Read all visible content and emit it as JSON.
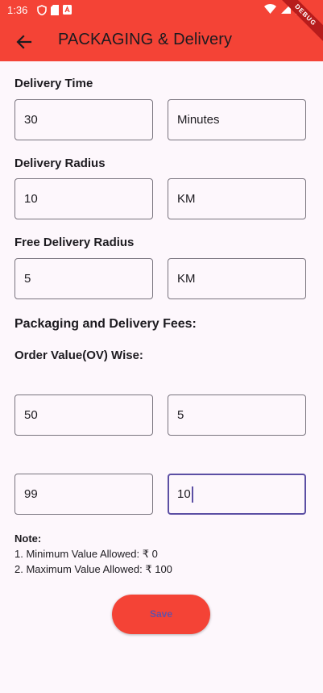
{
  "status_bar": {
    "time": "1:36",
    "icons_left": [
      "shield-icon",
      "sd-card-icon",
      "a-icon"
    ],
    "icons_right": [
      "wifi-icon",
      "signal-icon",
      "battery-icon"
    ]
  },
  "app_bar": {
    "title": "PACKAGING & Delivery",
    "debug_banner": "DEBUG"
  },
  "delivery_time": {
    "label": "Delivery Time",
    "value": "30",
    "unit": "Minutes"
  },
  "delivery_radius": {
    "label": "Delivery Radius",
    "value": "10",
    "unit": "KM"
  },
  "free_delivery_radius": {
    "label": "Free Delivery Radius",
    "value": "5",
    "unit": "KM"
  },
  "fees": {
    "title": "Packaging and Delivery Fees:",
    "subtitle": "Order Value(OV) Wise:",
    "rows": [
      {
        "order_value": "50",
        "fee": "5"
      },
      {
        "order_value": "99",
        "fee": "10"
      }
    ]
  },
  "note": {
    "heading": "Note:",
    "line1": "1. Minimum Value Allowed: ₹ 0",
    "line2": "2. Maximum Value Allowed: ₹ 100"
  },
  "save_label": "Save",
  "colors": {
    "primary": "#f44336",
    "accent": "#5c4fa4",
    "background": "#fdf7fc"
  }
}
